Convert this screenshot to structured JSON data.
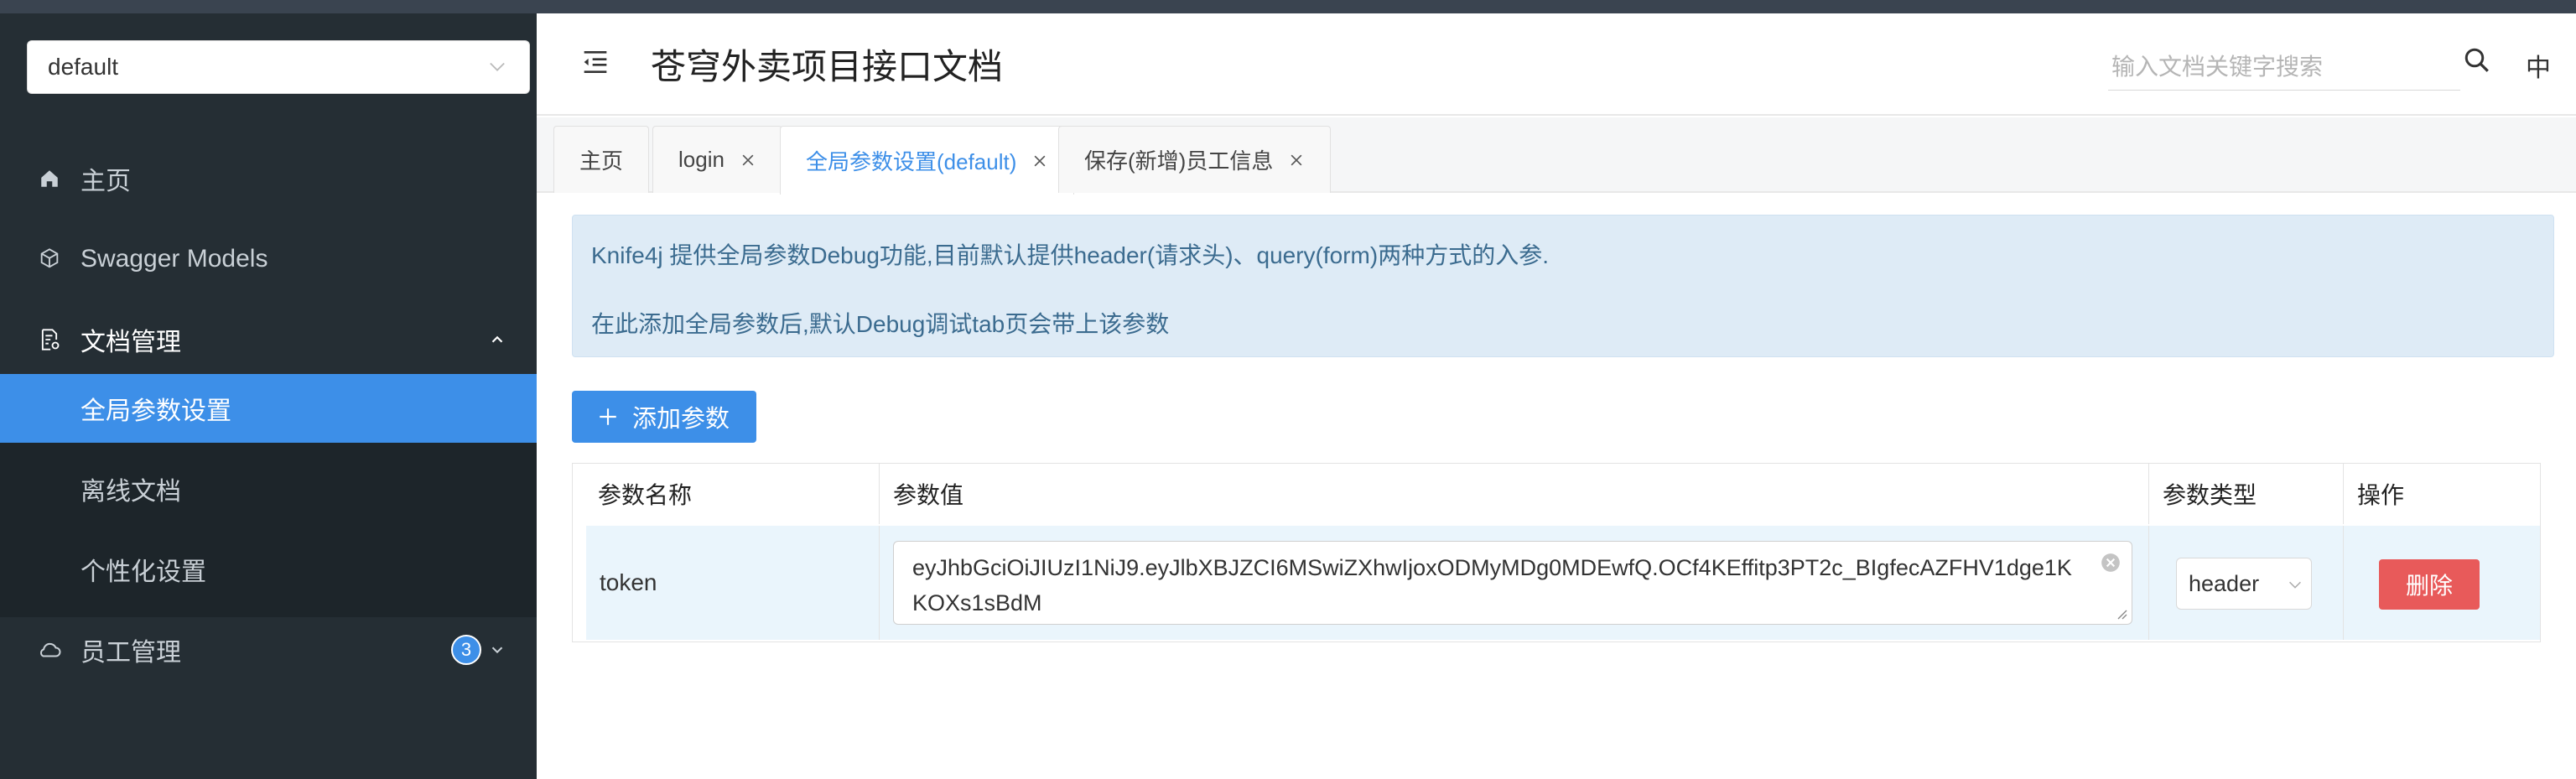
{
  "sidebar": {
    "space_select": {
      "value": "default"
    },
    "items": [
      {
        "label": "主页",
        "icon": "home-icon"
      },
      {
        "label": "Swagger Models",
        "icon": "cube-icon"
      },
      {
        "label": "文档管理",
        "icon": "doc-settings-icon",
        "expanded": true
      },
      {
        "label": "全局参数设置",
        "active": true
      },
      {
        "label": "离线文档"
      },
      {
        "label": "个性化设置"
      },
      {
        "label": "员工管理",
        "icon": "cloud-icon",
        "badge": "3"
      }
    ]
  },
  "header": {
    "title": "苍穹外卖项目接口文档",
    "search_placeholder": "输入文档关键字搜索",
    "lang": "中"
  },
  "tabs": [
    {
      "label": "主页",
      "closable": false
    },
    {
      "label": "login",
      "closable": true
    },
    {
      "label": "全局参数设置(default)",
      "closable": true,
      "active": true
    },
    {
      "label": "保存(新增)员工信息",
      "closable": true
    }
  ],
  "alert": {
    "line1": "Knife4j 提供全局参数Debug功能,目前默认提供header(请求头)、query(form)两种方式的入参.",
    "line2": "在此添加全局参数后,默认Debug调试tab页会带上该参数"
  },
  "add_button": {
    "label": "添加参数"
  },
  "table": {
    "headers": [
      "参数名称",
      "参数值",
      "参数类型",
      "操作"
    ],
    "rows": [
      {
        "name": "token",
        "value": "eyJhbGciOiJIUzI1NiJ9.eyJlbXBJZCI6MSwiZXhwIjoxODMyMDg0MDEwfQ.OCf4KEffitp3PT2c_BIgfecAZFHV1dge1KKOXs1sBdM",
        "type": "header",
        "action": "删除"
      }
    ]
  },
  "colors": {
    "sidebar_bg": "#252e34",
    "accent": "#3d8fe8",
    "danger": "#e85a5a",
    "alert_bg": "#deebf6"
  }
}
